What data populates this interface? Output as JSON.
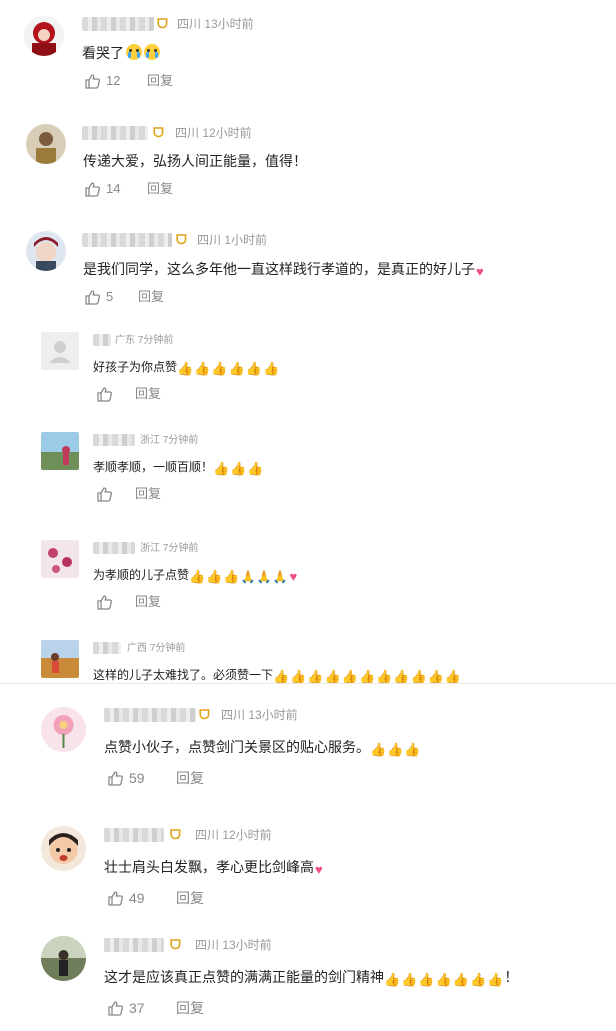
{
  "comments_top": [
    {
      "location_time": "四川 13小时前",
      "text": "看哭了",
      "emoji": [
        "cry",
        "cry"
      ],
      "likes": "12",
      "reply": "回复"
    },
    {
      "location_time": "四川 12小时前",
      "text": "传递大爱，弘扬人间正能量，值得！",
      "emoji": [],
      "likes": "14",
      "reply": "回复"
    },
    {
      "location_time": "四川 1小时前",
      "text": "是我们同学，这么多年他一直这样践行孝道的，是真正的好儿子",
      "emoji": [
        "heart"
      ],
      "likes": "5",
      "reply": "回复"
    }
  ],
  "replies": [
    {
      "location_time": "广东 7分钟前",
      "text": "好孩子为你点赞",
      "emoji": [
        "thumb",
        "thumb",
        "thumb",
        "thumb",
        "thumb",
        "thumb"
      ],
      "reply": "回复"
    },
    {
      "location_time": "浙江 7分钟前",
      "text": "孝顺孝顺，一顺百顺！",
      "emoji": [
        "thumb",
        "thumb",
        "thumb"
      ],
      "reply": "回复"
    },
    {
      "location_time": "浙江 7分钟前",
      "text": "为孝顺的儿子点赞",
      "emoji": [
        "thumb",
        "thumb",
        "thumb",
        "pray",
        "pray",
        "pray",
        "heart"
      ],
      "reply": "回复"
    },
    {
      "location_time": "广西 7分钟前",
      "text": "这样的儿子太难找了。必须赞一下",
      "emoji": [
        "thumb",
        "thumb",
        "thumb",
        "thumb",
        "thumb",
        "thumb",
        "thumb",
        "thumb",
        "thumb",
        "thumb",
        "thumb"
      ],
      "reply": ""
    }
  ],
  "comments_bottom": [
    {
      "location_time": "四川 13小时前",
      "text": "点赞小伙子，点赞剑门关景区的贴心服务。",
      "emoji": [
        "thumb",
        "thumb",
        "thumb"
      ],
      "suffix": "",
      "likes": "59",
      "reply": "回复"
    },
    {
      "location_time": "四川 12小时前",
      "text": "壮士肩头白发飘，孝心更比剑峰高",
      "emoji": [
        "heart"
      ],
      "suffix": "",
      "likes": "49",
      "reply": "回复"
    },
    {
      "location_time": "四川 13小时前",
      "text": "这才是应该真正点赞的满满正能量的剑门精神",
      "emoji": [
        "thumb",
        "thumb",
        "thumb",
        "thumb",
        "thumb",
        "thumb",
        "thumb"
      ],
      "suffix": "！",
      "likes": "37",
      "reply": "回复"
    }
  ],
  "colors": {
    "vip": "#e0a31b",
    "meta": "#999999",
    "accent_heart": "#ee4f82",
    "thumb_emoji": "#e9a60d"
  },
  "icons": {
    "like": "thumb-up-outline-icon",
    "vip": "vip-badge-icon",
    "cry": "crying-face-emoji",
    "thumb": "thumbs-up-emoji",
    "pray": "pray-emoji",
    "heart": "heart-emoji"
  }
}
